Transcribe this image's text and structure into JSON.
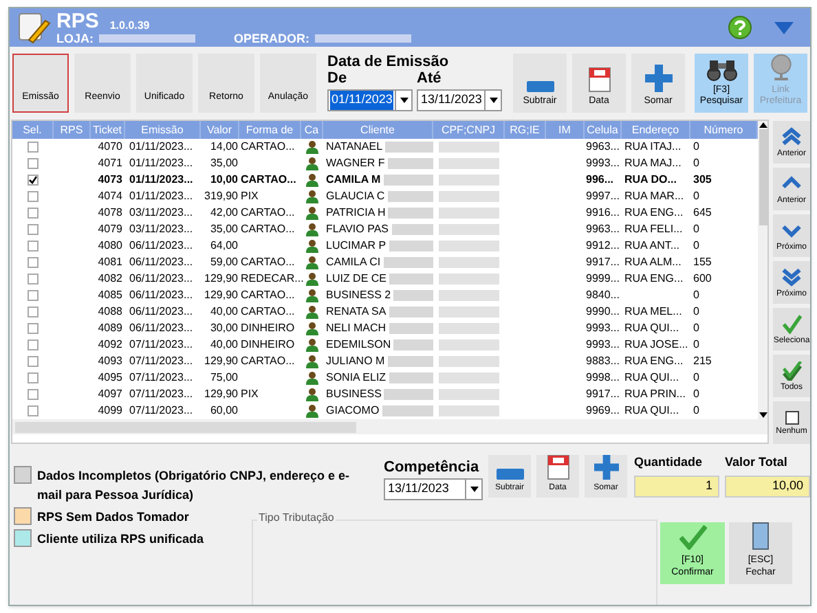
{
  "header": {
    "title": "RPS",
    "version": "1.0.0.39",
    "store_label": "LOJA:",
    "operator_label": "OPERADOR:"
  },
  "toolbar": {
    "modes": [
      {
        "label": "Emissão",
        "selected": true
      },
      {
        "label": "Reenvio",
        "selected": false
      },
      {
        "label": "Unificado",
        "selected": false
      },
      {
        "label": "Retorno",
        "selected": false
      },
      {
        "label": "Anulação",
        "selected": false
      }
    ],
    "date_title": "Data de Emissão",
    "from_label": "De",
    "from_value": "01/11/2023",
    "to_label": "Até",
    "to_value": "13/11/2023",
    "actions": [
      {
        "kind": "minus",
        "label": "Subtrair",
        "disabled": false
      },
      {
        "kind": "calendar",
        "label": "Data",
        "disabled": false
      },
      {
        "kind": "plus",
        "label": "Somar",
        "disabled": false
      },
      {
        "kind": "binoculars",
        "label": "[F3]\nPesquisar",
        "disabled": false
      },
      {
        "kind": "globe",
        "label": "Link\nPrefeitura",
        "disabled": true
      }
    ]
  },
  "table": {
    "columns": [
      "Sel.",
      "RPS",
      "Ticket",
      "Emissão",
      "Valor",
      "Forma de",
      "Ca",
      "Cliente",
      "CPF;CNPJ",
      "RG;IE",
      "IM",
      "Celula",
      "Endereço",
      "Número"
    ],
    "rows": [
      {
        "checked": false,
        "ticket": "4070",
        "emissao": "01/11/2023...",
        "valor": "14,00",
        "forma": "CARTAO...",
        "cliente": "NATANAEL",
        "celula": "9963...",
        "endereco": "RUA ITAJ...",
        "numero": "0"
      },
      {
        "checked": false,
        "ticket": "4071",
        "emissao": "01/11/2023...",
        "valor": "35,00",
        "cliente": "WAGNER F",
        "celula": "9993...",
        "endereco": "RUA MAJ...",
        "numero": "0"
      },
      {
        "checked": true,
        "ticket": "4073",
        "emissao": "01/11/2023...",
        "valor": "10,00",
        "forma": "CARTAO...",
        "cliente": "CAMILA M",
        "celula": "996...",
        "endereco": "RUA DO...",
        "numero": "305"
      },
      {
        "checked": false,
        "ticket": "4074",
        "emissao": "01/11/2023...",
        "valor": "319,90",
        "forma": "PIX",
        "cliente": "GLAUCIA C",
        "celula": "9997...",
        "endereco": "RUA MAR...",
        "numero": "0"
      },
      {
        "checked": false,
        "ticket": "4078",
        "emissao": "03/11/2023...",
        "valor": "42,00",
        "forma": "CARTAO...",
        "cliente": "PATRICIA H",
        "celula": "9916...",
        "endereco": "RUA ENG...",
        "numero": "645"
      },
      {
        "checked": false,
        "ticket": "4079",
        "emissao": "03/11/2023...",
        "valor": "35,00",
        "forma": "CARTAO...",
        "cliente": "FLAVIO PAS",
        "celula": "9963...",
        "endereco": "RUA FELI...",
        "numero": "0"
      },
      {
        "checked": false,
        "ticket": "4080",
        "emissao": "06/11/2023...",
        "valor": "64,00",
        "cliente": "LUCIMAR P",
        "celula": "9912...",
        "endereco": "RUA ANT...",
        "numero": "0"
      },
      {
        "checked": false,
        "ticket": "4081",
        "emissao": "06/11/2023...",
        "valor": "59,00",
        "forma": "CARTAO...",
        "cliente": "CAMILA CI",
        "celula": "9917...",
        "endereco": "RUA ALM...",
        "numero": "155"
      },
      {
        "checked": false,
        "ticket": "4082",
        "emissao": "06/11/2023...",
        "valor": "129,90",
        "forma": "REDECAR...",
        "cliente": "LUIZ DE CE",
        "celula": "9999...",
        "endereco": "RUA ENG...",
        "numero": "600"
      },
      {
        "checked": false,
        "ticket": "4085",
        "emissao": "06/11/2023...",
        "valor": "129,90",
        "forma": "CARTAO...",
        "cliente": "BUSINESS 2",
        "celula": "9840...",
        "numero": "0"
      },
      {
        "checked": false,
        "ticket": "4088",
        "emissao": "06/11/2023...",
        "valor": "40,00",
        "forma": "CARTAO...",
        "cliente": "RENATA SA",
        "celula": "9990...",
        "endereco": "RUA MEL...",
        "numero": "0"
      },
      {
        "checked": false,
        "ticket": "4089",
        "emissao": "06/11/2023...",
        "valor": "30,00",
        "forma": "DINHEIRO",
        "cliente": "NELI MACH",
        "celula": "9993...",
        "endereco": "RUA QUI...",
        "numero": "0"
      },
      {
        "checked": false,
        "ticket": "4092",
        "emissao": "07/11/2023...",
        "valor": "40,00",
        "forma": "DINHEIRO",
        "cliente": "EDEMILSON",
        "celula": "9993...",
        "endereco": "RUA JOSE...",
        "numero": "0"
      },
      {
        "checked": false,
        "ticket": "4093",
        "emissao": "07/11/2023...",
        "valor": "129,90",
        "forma": "CARTAO...",
        "cliente": "JULIANO M",
        "celula": "9883...",
        "endereco": "RUA ENG...",
        "numero": "215"
      },
      {
        "checked": false,
        "ticket": "4095",
        "emissao": "07/11/2023...",
        "valor": "75,00",
        "cliente": "SONIA ELIZ",
        "celula": "9998...",
        "endereco": "RUA QUI...",
        "numero": "0"
      },
      {
        "checked": false,
        "ticket": "4097",
        "emissao": "07/11/2023...",
        "valor": "129,90",
        "forma": "PIX",
        "cliente": "BUSINESS",
        "celula": "9917...",
        "endereco": "RUA PRIN...",
        "numero": "0"
      },
      {
        "checked": false,
        "ticket": "4099",
        "emissao": "07/11/2023...",
        "valor": "60,00",
        "cliente": "GIACOMO",
        "celula": "9969...",
        "endereco": "RUA QUI...",
        "numero": "0"
      }
    ]
  },
  "nav": [
    {
      "kind": "double-up",
      "label": "Anterior"
    },
    {
      "kind": "up",
      "label": "Anterior"
    },
    {
      "kind": "down",
      "label": "Próximo"
    },
    {
      "kind": "double-down",
      "label": "Próximo"
    },
    {
      "kind": "check",
      "label": "Seleciona"
    },
    {
      "kind": "double-check",
      "label": "Todos"
    },
    {
      "kind": "box",
      "label": "Nenhum"
    }
  ],
  "legend": [
    {
      "color": "#d4d4d4",
      "label": "Dados Incompletos (Obrigatório CNPJ, endereço e e-mail para Pessoa Jurídica)"
    },
    {
      "color": "#fcd9a8",
      "label": "RPS Sem Dados Tomador"
    },
    {
      "color": "#aee9e9",
      "label": "Cliente utiliza RPS unificada"
    }
  ],
  "competencia": {
    "label": "Competência",
    "value": "13/11/2023"
  },
  "bottom_actions": [
    {
      "kind": "minus",
      "label": "Subtrair"
    },
    {
      "kind": "calendar",
      "label": "Data"
    },
    {
      "kind": "plus",
      "label": "Somar"
    }
  ],
  "quantidade": {
    "label": "Quantidade",
    "value": "1"
  },
  "valor_total": {
    "label": "Valor Total",
    "value": "10,00"
  },
  "tipo_tributacao": {
    "label": "Tipo Tributação"
  },
  "confirm": {
    "label": "[F10]\nConfirmar"
  },
  "close": {
    "label": "[ESC]\nFechar"
  }
}
